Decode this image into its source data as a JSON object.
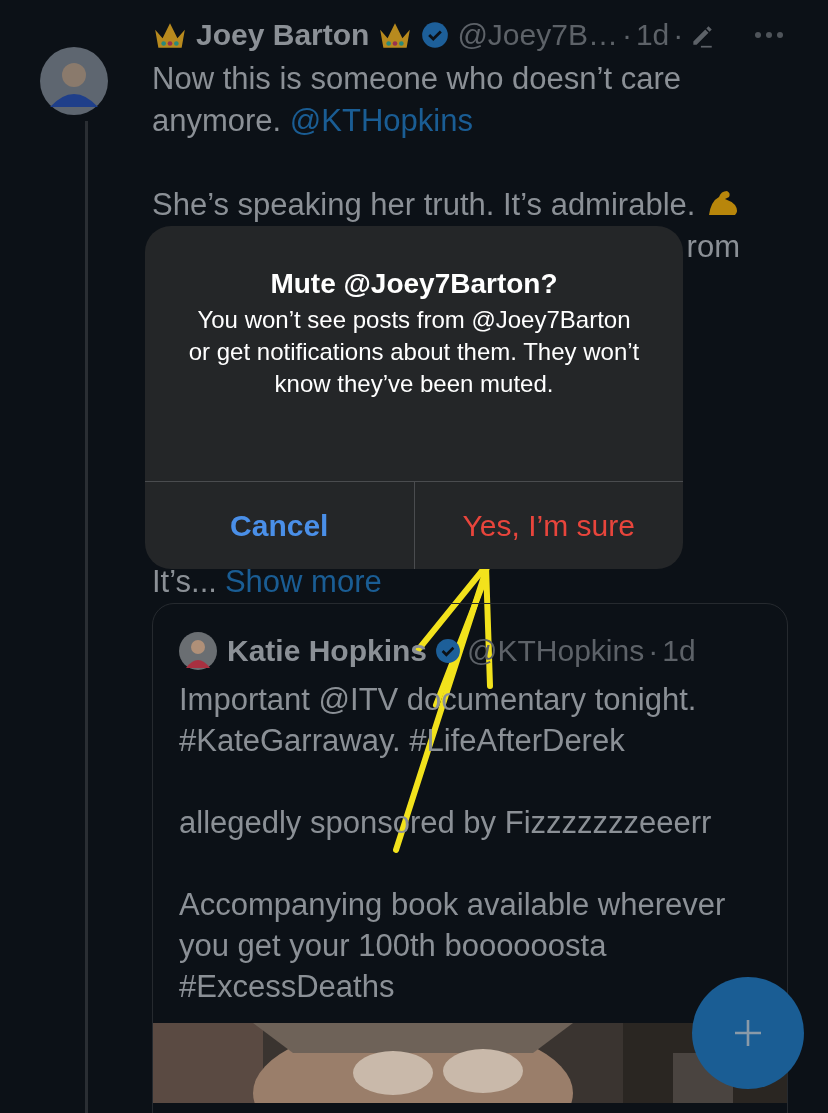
{
  "post": {
    "author": {
      "name": "Joey Barton",
      "handle": "@Joey7B…",
      "time": "1d",
      "separator": "·",
      "verified": true,
      "edited": true
    },
    "paragraphs": [
      {
        "text": "Now this is someone who doesn’t care anymore. ",
        "link": "@KTHopkins",
        "emoji": false
      },
      {
        "text": "She’s speaking her truth. It’s admirable.",
        "emoji": true
      }
    ],
    "covered_fragment": "rom",
    "truncated_text": "It’s...",
    "show_more": "Show more",
    "quote": {
      "author": {
        "name": "Katie Hopkins",
        "handle": "@KTHopkins",
        "time": "1d",
        "separator": "·",
        "verified": true
      },
      "paragraphs": [
        [
          "Important @ITV documentary tonight.",
          "#KateGarraway. #LifeAfterDerek"
        ],
        [
          "allegedly sponsored by Fizzzzzzzeeerr"
        ],
        [
          "Accompanying book available wherever",
          "you get your 100th boooooosta",
          "#ExcessDeaths"
        ]
      ],
      "media": {
        "kind": "picture"
      }
    }
  },
  "dialog": {
    "title": "Mute @Joey7Barton?",
    "message": "You won’t see posts from @Joey7Barton or get notifications about them. They won’t know they’ve been muted.",
    "buttons": [
      {
        "label": "Cancel",
        "kind": "cancel"
      },
      {
        "label": "Yes, I’m sure",
        "kind": "destructive"
      }
    ]
  },
  "compose_button": {
    "kind": "plus"
  }
}
